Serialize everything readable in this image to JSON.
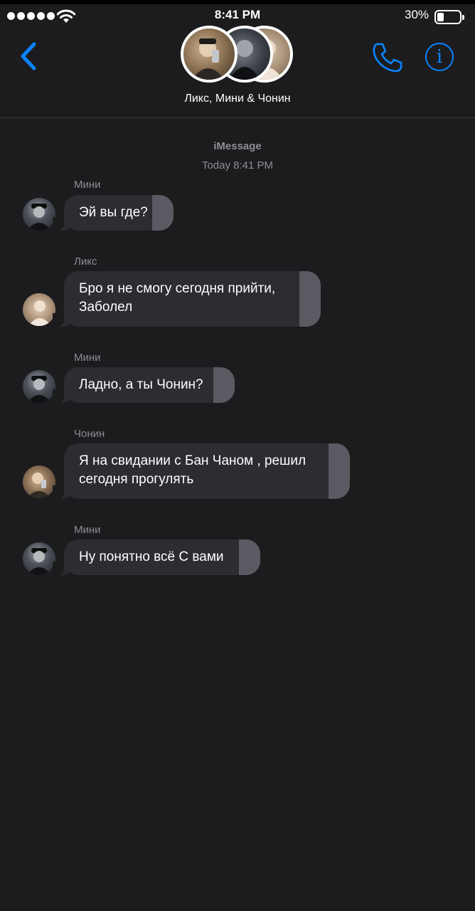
{
  "status_bar": {
    "time": "8:41 PM",
    "battery_percent": "30%",
    "battery_level": 0.3,
    "signal_bars": 5
  },
  "header": {
    "back_icon": "chevron-left-icon",
    "group_name": "Ликс, Мини & Чонин",
    "call_icon": "phone-icon",
    "info_icon": "info-icon",
    "accent_color": "#0a84ff"
  },
  "conversation": {
    "service": "iMessage",
    "timestamp": "Today 8:41 PM",
    "messages": [
      {
        "sender": "Мини",
        "text": "Эй вы где?"
      },
      {
        "sender": "Ликс",
        "text_lines": [
          "Бро я не смогу сегодня прийти,",
          "Заболел"
        ]
      },
      {
        "sender": "Мини",
        "text": "Ладно, а ты Чонин?"
      },
      {
        "sender": "Чонин",
        "text_lines": [
          "Я на свидании с Бан Чаном  , решил",
          "сегодня прогулять"
        ]
      },
      {
        "sender": "Мини",
        "text": "Ну понятно всё С вами"
      }
    ]
  },
  "colors": {
    "background": "#1c1c1e",
    "bubble": "#2c2c31",
    "meta_text": "#8e8e93"
  }
}
